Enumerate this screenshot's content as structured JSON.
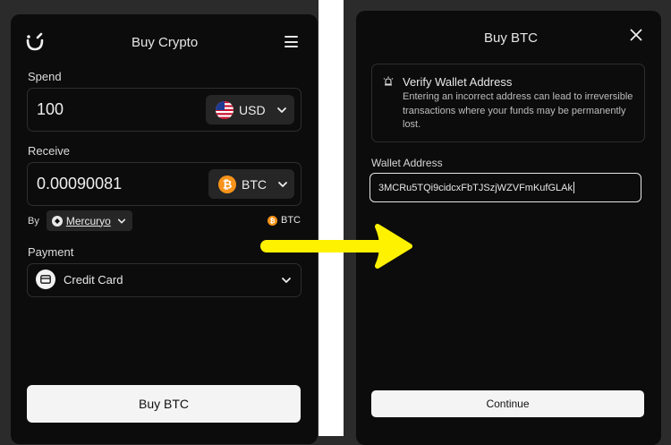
{
  "left_panel": {
    "title": "Buy Crypto",
    "spend": {
      "label": "Spend",
      "value": "100",
      "currency": "USD"
    },
    "receive": {
      "label": "Receive",
      "value": "0.00090081",
      "currency": "BTC"
    },
    "provider": {
      "by_label": "By",
      "name": "Mercuryo",
      "tag": "BTC"
    },
    "payment": {
      "label": "Payment",
      "method": "Credit Card"
    },
    "buy_button": "Buy BTC"
  },
  "right_panel": {
    "title": "Buy BTC",
    "warning": {
      "title": "Verify Wallet Address",
      "body": "Entering an incorrect address can lead to irreversible transactions where your funds may be permanently lost."
    },
    "wallet_label": "Wallet Address",
    "wallet_value": "3MCRu5TQi9cidcxFbTJSzjWZVFmKufGLAk",
    "continue_button": "Continue"
  },
  "colors": {
    "panel_bg": "#0c0c0c",
    "page_bg": "#2b2b2b",
    "arrow": "#fff200",
    "btc_orange": "#f7931a"
  }
}
